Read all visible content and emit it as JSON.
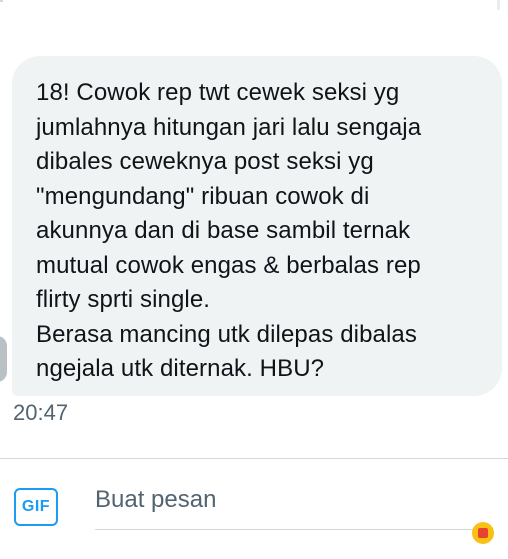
{
  "message": {
    "text": "18! Cowok rep twt cewek seksi yg\njumlahnya hitungan jari lalu sengaja\ndibales ceweknya post seksi yg\n\"mengundang\" ribuan cowok di\nakunnya dan di base sambil ternak\nmutual cowok engas & berbalas rep\nflirty sprti single.\nBerasa mancing utk dilepas dibalas\nngejala utk diternak. HBU?",
    "timestamp": "20:47"
  },
  "composer": {
    "gif_label": "GIF",
    "placeholder": "Buat pesan",
    "value": ""
  },
  "colors": {
    "bubble": "#eff3f4",
    "accent": "#1d9bf0",
    "muted_text": "#536471"
  }
}
